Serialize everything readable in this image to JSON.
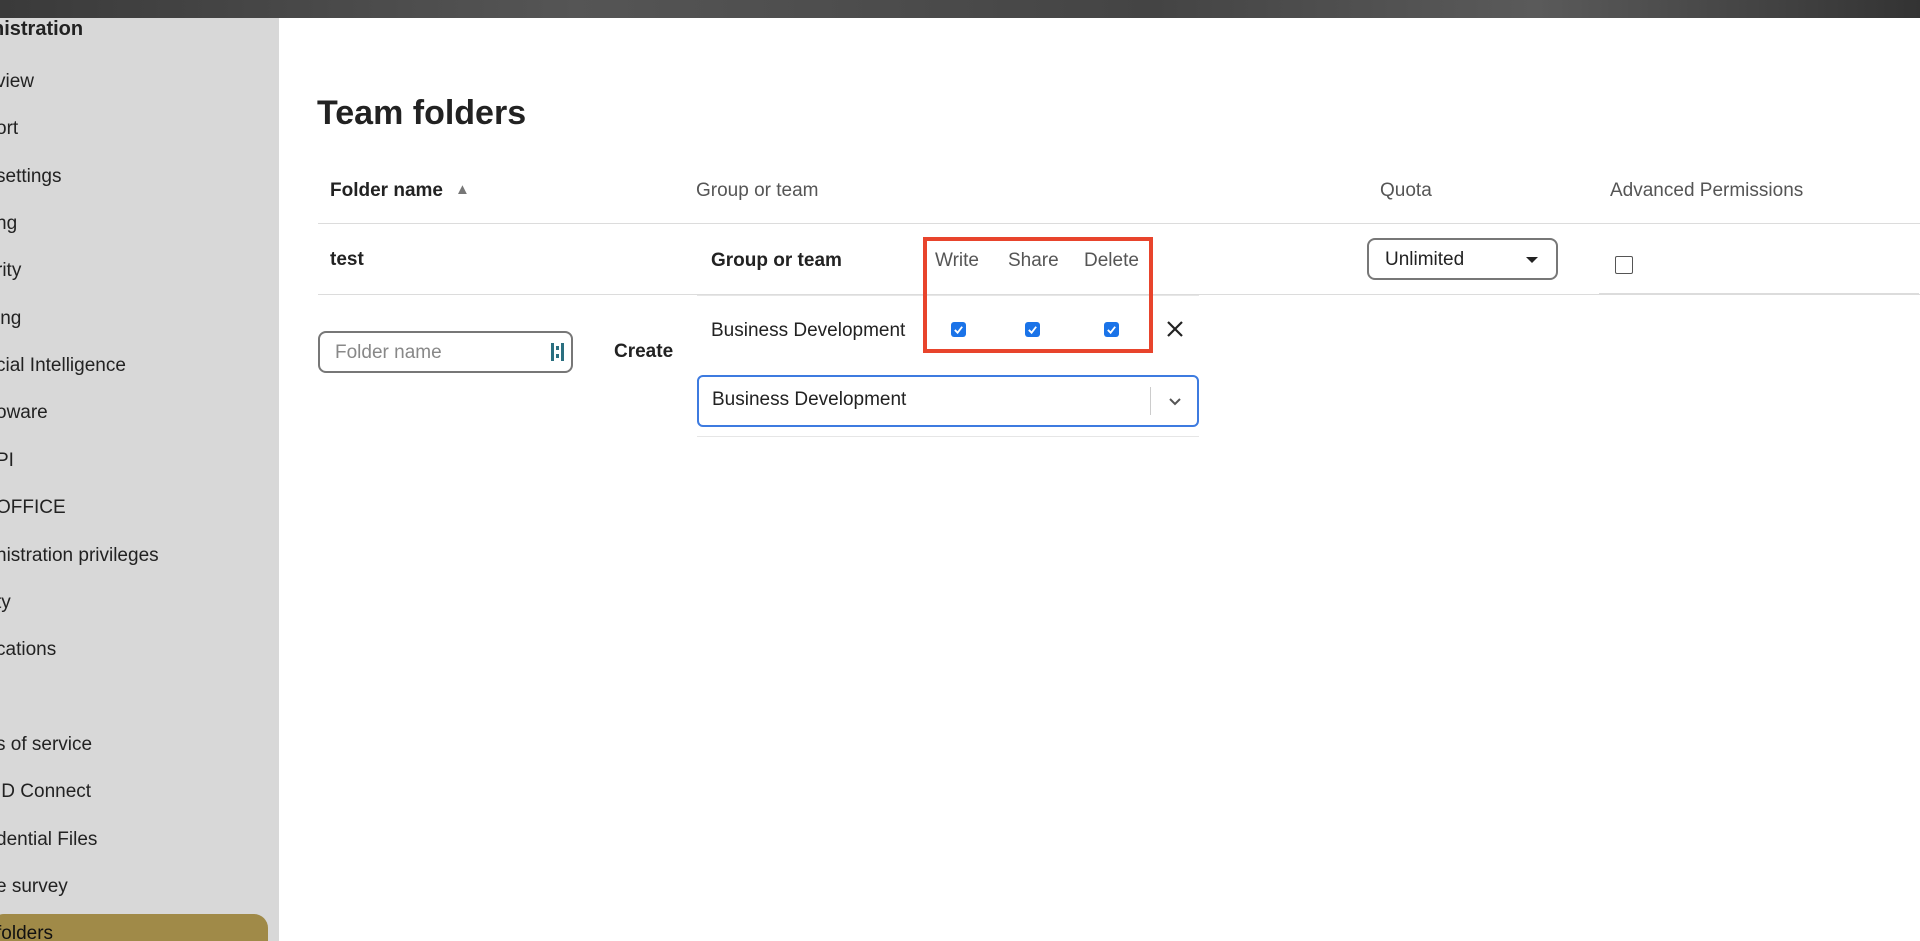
{
  "sidebar": {
    "section_title": "nistration",
    "items": [
      {
        "label": "view"
      },
      {
        "label": "ort"
      },
      {
        "label": " settings"
      },
      {
        "label": "ng"
      },
      {
        "label": "rity"
      },
      {
        "label": "ing"
      },
      {
        "label": "cial Intelligence"
      },
      {
        "label": "oware"
      },
      {
        "label": "PI"
      },
      {
        "label": "OFFICE"
      },
      {
        "label": "nistration privileges"
      },
      {
        "label": "ty"
      },
      {
        "label": "cations"
      },
      {
        "label": "s of service"
      },
      {
        "label": "ID Connect"
      },
      {
        "label": "dential Files"
      },
      {
        "label": "e survey"
      }
    ],
    "active_item": "folders",
    "active_color": "#a08a48"
  },
  "main": {
    "title": "Team folders",
    "columns": {
      "folder_name": "Folder name",
      "group_or_team": "Group or team",
      "quota": "Quota",
      "advanced_permissions": "Advanced Permissions"
    },
    "rows": [
      {
        "folder_name": "test",
        "groups_header": {
          "group_or_team": "Group or team",
          "write": "Write",
          "share": "Share",
          "delete": "Delete"
        },
        "groups": [
          {
            "name": "Business Development",
            "write": true,
            "share": true,
            "delete": true
          }
        ],
        "group_select_value": "Business Development",
        "quota": "Unlimited",
        "advanced_permissions": false
      }
    ],
    "new_folder": {
      "placeholder": "Folder name",
      "create_label": "Create"
    }
  },
  "colors": {
    "highlight": "#e8442c",
    "checkbox": "#1a73e8",
    "select_focus": "#3d7be0"
  }
}
